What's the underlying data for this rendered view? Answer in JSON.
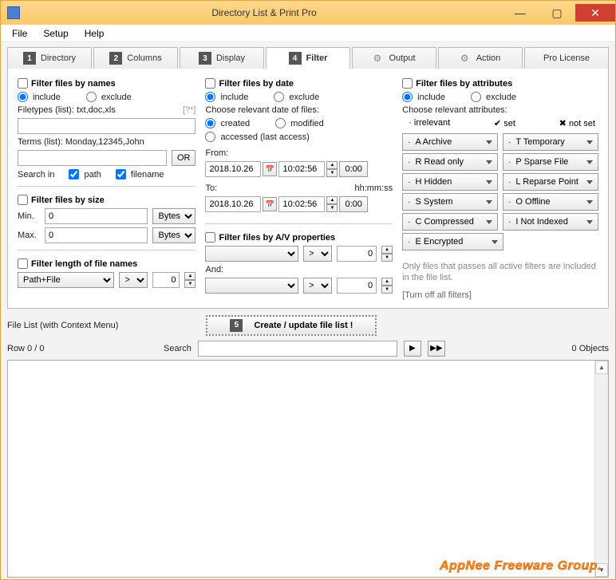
{
  "window": {
    "title": "Directory List & Print Pro"
  },
  "menu": {
    "file": "File",
    "setup": "Setup",
    "help": "Help"
  },
  "tabs": {
    "directory": "Directory",
    "columns": "Columns",
    "display": "Display",
    "filter": "Filter",
    "output": "Output",
    "action": "Action",
    "pro": "Pro License",
    "n1": "1",
    "n2": "2",
    "n3": "3",
    "n4": "4",
    "n5": "5"
  },
  "names": {
    "title": "Filter files by names",
    "include": "include",
    "exclude": "exclude",
    "filetypes_lbl": "Filetypes (list): txt,doc,xls",
    "filetypes_hint": "[?*]",
    "terms_lbl": "Terms (list): Monday,12345,John",
    "or": "OR",
    "searchin": "Search in",
    "path": "path",
    "filename": "filename"
  },
  "size": {
    "title": "Filter files by size",
    "min": "Min.",
    "max": "Max.",
    "min_val": "0",
    "max_val": "0",
    "unit": "Bytes"
  },
  "len": {
    "title": "Filter length of file names",
    "mode": "Path+File",
    "op": ">",
    "val": "0"
  },
  "date": {
    "title": "Filter files by date",
    "include": "include",
    "exclude": "exclude",
    "choose": "Choose relevant date of files:",
    "created": "created",
    "modified": "modified",
    "accessed": "accessed (last access)",
    "from": "From:",
    "to": "To:",
    "hhmmss": "hh:mm:ss",
    "from_date": "2018.10.26",
    "from_time": "10:02:56",
    "to_date": "2018.10.26",
    "to_time": "10:02:56",
    "zero": "0:00"
  },
  "av": {
    "title": "Filter files by A/V properties",
    "and": "And:",
    "op": ">",
    "val": "0"
  },
  "attr": {
    "title": "Filter files by attributes",
    "include": "include",
    "exclude": "exclude",
    "choose": "Choose relevant attributes:",
    "irrelevant": "irrelevant",
    "set": "set",
    "notset": "not set",
    "items": [
      {
        "l": "A  Archive",
        "r": "T  Temporary"
      },
      {
        "l": "R  Read only",
        "r": "P  Sparse File"
      },
      {
        "l": "H  Hidden",
        "r": "L  Reparse Point"
      },
      {
        "l": "S  System",
        "r": "O  Offline"
      },
      {
        "l": "C  Compressed",
        "r": "I  Not Indexed"
      },
      {
        "l": "E  Encrypted",
        "r": ""
      }
    ],
    "note": "Only files that passes all active filters are included in the file list.",
    "turnoff": "[Turn off all filters]"
  },
  "filelist": {
    "label": "File List (with Context Menu)",
    "create": "Create / update file list !",
    "rows": "Row 0 / 0",
    "search": "Search",
    "objects": "0 Objects"
  },
  "watermark": "AppNee Freeware Group."
}
